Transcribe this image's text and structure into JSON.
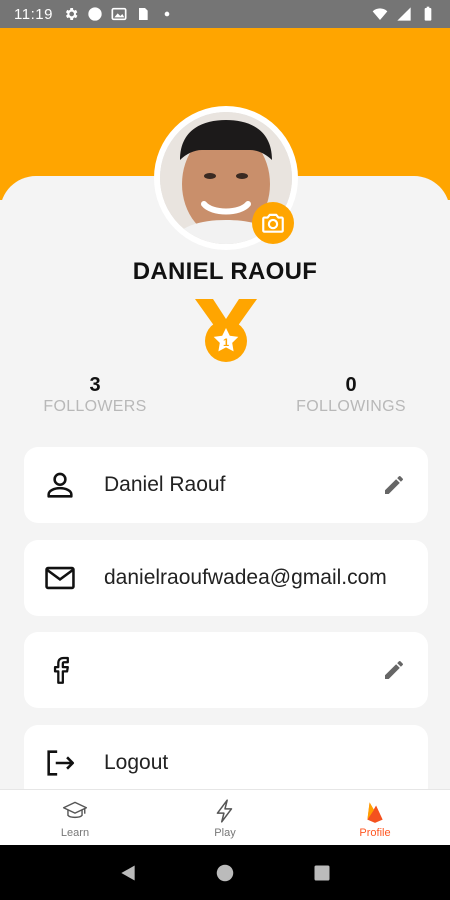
{
  "status_bar": {
    "time": "11:19",
    "left_icons": [
      "gear-icon",
      "circle-icon",
      "image-icon",
      "sim-card-icon",
      "dot-icon"
    ],
    "right_icons": [
      "wifi-icon",
      "signal-icon",
      "battery-icon"
    ]
  },
  "profile": {
    "name": "DANIEL RAOUF",
    "avatar_icon": "avatar",
    "camera_icon": "camera-icon",
    "medal": {
      "icon": "medal-icon",
      "rank": "1"
    }
  },
  "stats": {
    "followers": {
      "value": "3",
      "label": "FOLLOWERS"
    },
    "followings": {
      "value": "0",
      "label": "FOLLOWINGS"
    }
  },
  "cards": [
    {
      "icon": "person-icon",
      "text": "Daniel Raouf",
      "editable": true
    },
    {
      "icon": "mail-icon",
      "text": "danielraoufwadea@gmail.com",
      "editable": false
    },
    {
      "icon": "facebook-icon",
      "text": "",
      "editable": true
    },
    {
      "icon": "logout-icon",
      "text": "Logout",
      "editable": false
    }
  ],
  "bottom_nav": {
    "items": [
      {
        "label": "Learn",
        "icon": "graduation-cap-icon",
        "active": false
      },
      {
        "label": "Play",
        "icon": "lightning-icon",
        "active": false
      },
      {
        "label": "Profile",
        "icon": "flame-icon",
        "active": true
      }
    ]
  },
  "colors": {
    "accent": "#ffa500",
    "active_nav": "#ff5722",
    "background": "#f4f4f4"
  }
}
